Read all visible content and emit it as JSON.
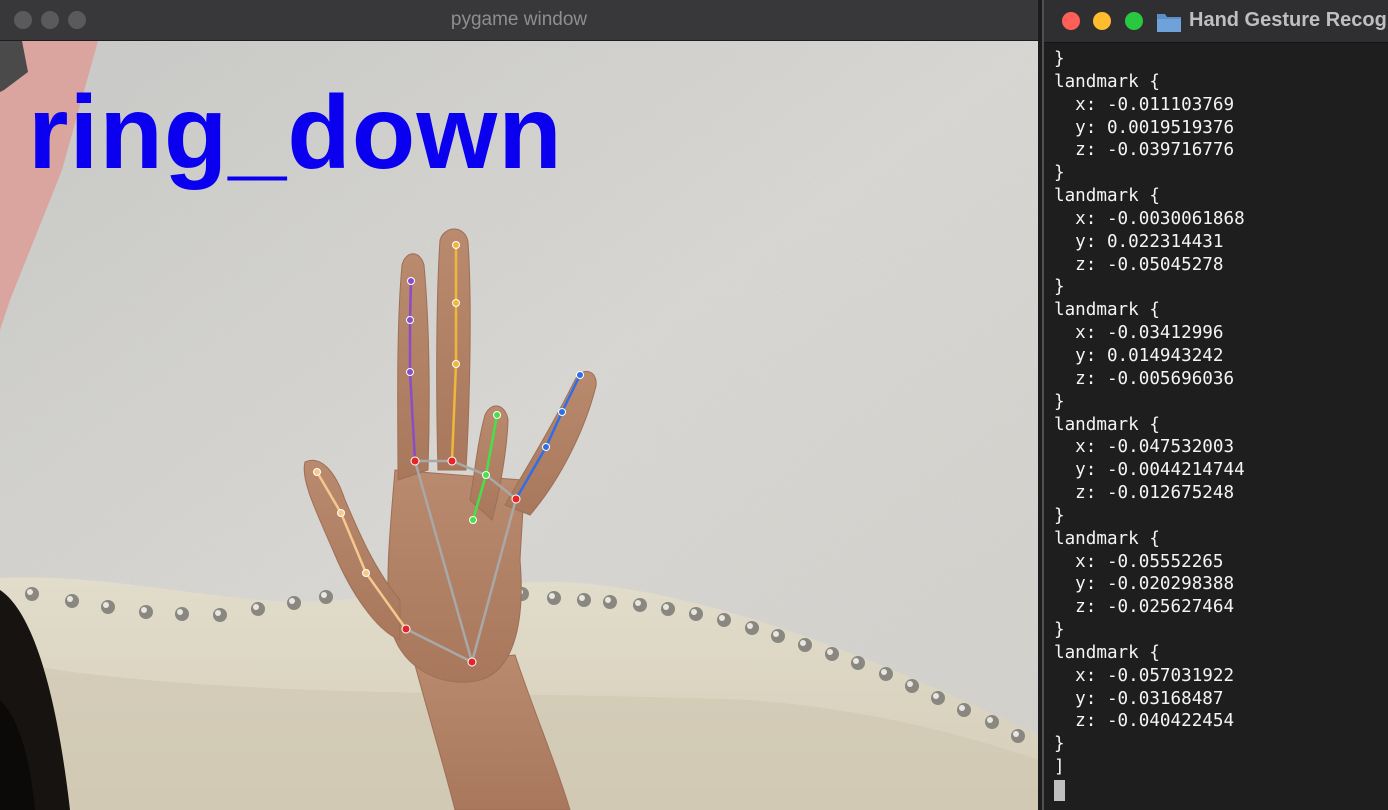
{
  "pygame_window": {
    "title": "pygame window",
    "gesture_label": "ring_down",
    "label_color": "#0a00ef"
  },
  "terminal_window": {
    "title": "Hand Gesture Recog",
    "folder_icon": "folder-icon",
    "lines": [
      "}",
      "landmark {",
      "  x: -0.011103769",
      "  y: 0.0019519376",
      "  z: -0.039716776",
      "}",
      "landmark {",
      "  x: -0.0030061868",
      "  y: 0.022314431",
      "  z: -0.05045278",
      "}",
      "landmark {",
      "  x: -0.03412996",
      "  y: 0.014943242",
      "  z: -0.005696036",
      "}",
      "landmark {",
      "  x: -0.047532003",
      "  y: -0.0044214744",
      "  z: -0.012675248",
      "}",
      "landmark {",
      "  x: -0.05552265",
      "  y: -0.020298388",
      "  z: -0.025627464",
      "}",
      "landmark {",
      "  x: -0.057031922",
      "  y: -0.03168487",
      "  z: -0.040422454",
      "}",
      "]"
    ]
  },
  "colors": {
    "thumb": "#f7c78d",
    "index": "#2e6fe8",
    "middle": "#48e048",
    "ring": "#f0b838",
    "pinky": "#8a4cc8",
    "palm": "#a8a8a8",
    "joint": "#e32626",
    "traffic_close": "#ff5f57",
    "traffic_min": "#febc2e",
    "traffic_zoom": "#28c840"
  }
}
